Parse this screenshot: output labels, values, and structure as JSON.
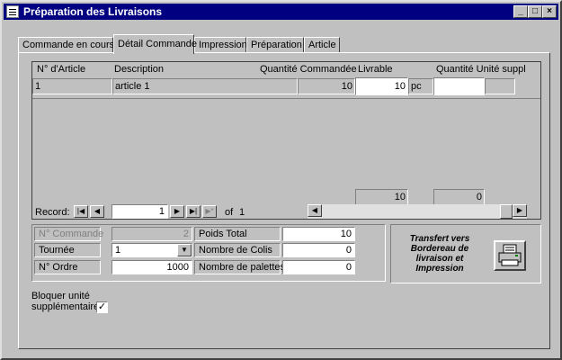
{
  "window": {
    "title": "Préparation des Livraisons",
    "minimize": "_",
    "maximize": "□",
    "close": "×"
  },
  "tabs": [
    {
      "label": "Commande en cours"
    },
    {
      "label": "Détail Commande"
    },
    {
      "label": "Impression"
    },
    {
      "label": "Préparation"
    },
    {
      "label": "Article"
    }
  ],
  "grid": {
    "headers": {
      "article": "N° d'Article",
      "description": "Description",
      "qty_ordered": "Quantité  Commandée",
      "deliverable": "Livrable",
      "qty_extra": "Quantité Unité suppl"
    },
    "rows": [
      {
        "article": "1",
        "description": "article 1",
        "ordered": "10",
        "deliverable": "10",
        "unit": "pc",
        "extra": ""
      }
    ],
    "totals": {
      "deliverable": "10",
      "extra": "0"
    }
  },
  "navigator": {
    "label": "Record:",
    "current": "1",
    "of_label": "of",
    "total": "1"
  },
  "details": {
    "order_no_label": "N° Commande",
    "order_no": "2",
    "route_label": "Tournée",
    "route": "1",
    "sequence_label": "N° Ordre",
    "sequence": "1000",
    "weight_label": "Poids Total",
    "weight": "10",
    "parcels_label": "Nombre de Colis",
    "parcels": "0",
    "pallets_label": "Nombre de palettes",
    "pallets": "0"
  },
  "transfer": {
    "line1": "Transfert vers",
    "line2": "Bordereau de",
    "line3": "livraison et",
    "line4": "Impression"
  },
  "lock": {
    "label_line1": "Bloquer unité",
    "label_line2": "supplémentaire",
    "checked": true
  }
}
